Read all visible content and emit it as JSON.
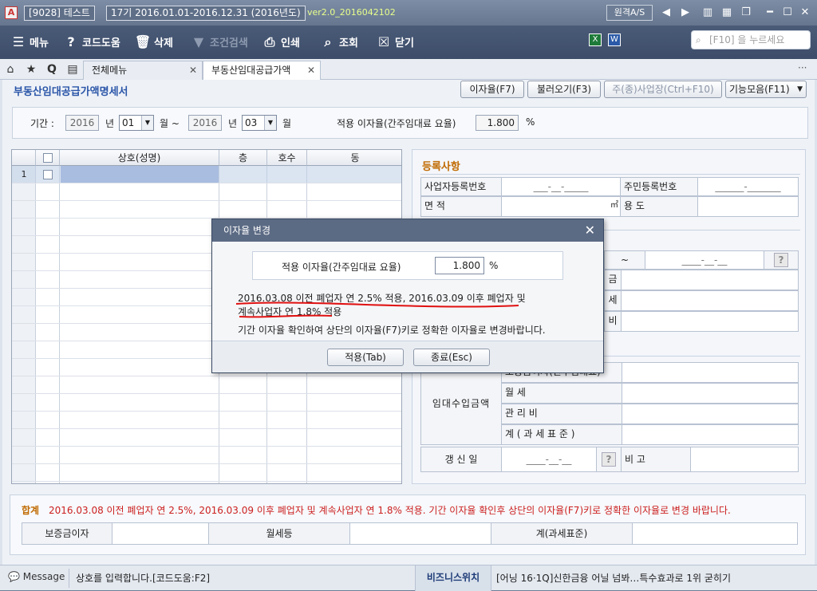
{
  "titlebar": {
    "app_icon": "A",
    "company": "[9028] 테스트",
    "period": "17기  2016.01.01-2016.12.31  (2016년도)",
    "version": "ver2.0_2016042102",
    "remote": "원격A/S"
  },
  "toolbar": {
    "menu": "메뉴",
    "code_help": "코드도움",
    "delete": "삭제",
    "cond_search": "조건검색",
    "print": "인쇄",
    "lookup": "조회",
    "close": "닫기",
    "search_placeholder": "[F10] 을 누르세요"
  },
  "tabs": {
    "all_menu": "전체메뉴",
    "active": "부동산임대공급가액"
  },
  "page": {
    "title": "부동산임대공급가액명세서",
    "btn_rate": "이자율(F7)",
    "btn_load": "불러오기(F3)",
    "btn_main_biz": "주(종)사업장(Ctrl+F10)",
    "btn_functions": "기능모음(F11)"
  },
  "period": {
    "label": "기간 :",
    "from_year": "2016",
    "year_unit": "년",
    "from_month": "01",
    "month_unit": "월 ~",
    "to_year": "2016",
    "to_month": "03",
    "month_unit2": "월",
    "rate_label": "적용 이자율(간주임대료 요율)",
    "rate_value": "1.800",
    "percent": "%"
  },
  "grid": {
    "headers": [
      "상호(성명)",
      "층",
      "호수",
      "동"
    ],
    "first_row_no": "1"
  },
  "registration": {
    "title": "등록사항",
    "biz_no_label": "사업자등록번호",
    "biz_no_value": "___-__-_____",
    "resident_no_label": "주민등록번호",
    "resident_no_value": "______-_______",
    "area_label": "면        적",
    "area_unit": "㎡",
    "usage_label": "용        도",
    "tilde": "~",
    "date_placeholder": "____-__-__",
    "help_q": "?",
    "right_frag_1": "금",
    "right_frag_2": "세",
    "right_frag_3": "비",
    "deposit_partial": "보증금이자(간주임대료)",
    "rental_income_label": "임대수입금액",
    "monthly_rent": "월        세",
    "mgmt_fee": "관   리   비",
    "total_taxbase": "계 ( 과 세 표 준 )",
    "renewal_label": "갱  신  일",
    "renewal_value": "____-__-__",
    "remarks_label": "비        고"
  },
  "totals": {
    "label": "합계",
    "notice": "2016.03.08 이전 폐업자 연 2.5%, 2016.03.09 이후 폐업자 및 계속사업자 연 1.8% 적용. 기간 이자율 확인후 상단의 이자율(F7)키로 정확한 이자율로 변경 바랍니다.",
    "col_deposit": "보증금이자",
    "col_monthly": "월세등",
    "col_total": "계(과세표준)"
  },
  "statusbar": {
    "message_label": "Message",
    "message": "상호를 입력합니다.[코드도움:F2]",
    "biz_switch": "비즈니스위치",
    "ticker": "[어닝 16·1Q]신한금융 어닐 넘봐…특수효과로 1위 굳히기"
  },
  "modal": {
    "title": "이자율 변경",
    "rate_label": "적용 이자율(간주임대료 요율)",
    "rate_value": "1.800",
    "percent": "%",
    "note_line1": "2016.03.08 이전 폐업자 연 2.5% 적용,  2016.03.09 이후 폐업자 및",
    "note_line2": "계속사업자 연 1.8% 적용",
    "note_line3": "기간 이자율 확인하여 상단의 이자율(F7)키로 정확한 이자율로 변경바랍니다.",
    "btn_apply": "적용(Tab)",
    "btn_close": "종료(Esc)"
  },
  "colors": {
    "accent_blue": "#2a55a8",
    "warning_red": "#cc1f1f",
    "section_orange": "#c06a00",
    "annotation_red": "#e01010"
  }
}
